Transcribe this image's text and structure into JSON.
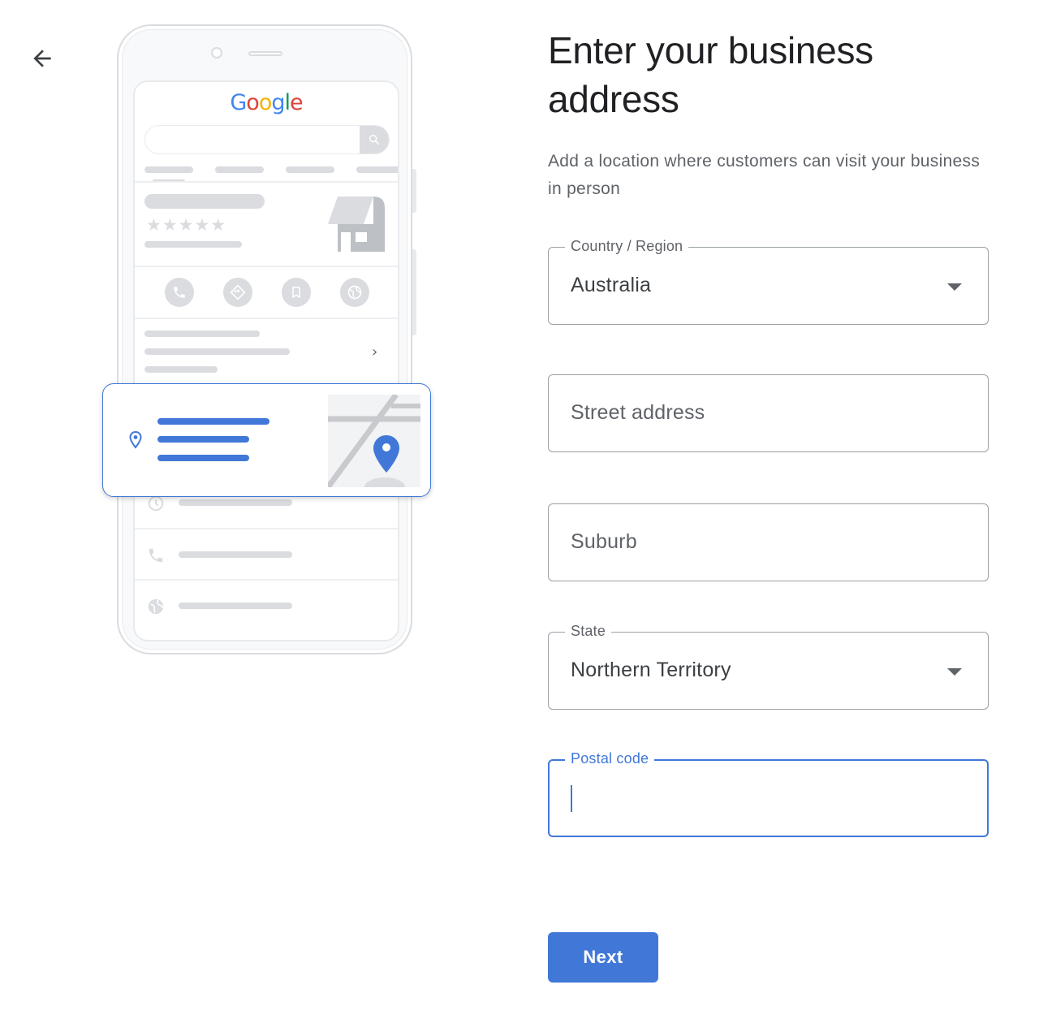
{
  "nav": {
    "back_label": "Back"
  },
  "illustration": {
    "logo_letters": [
      {
        "ch": "G",
        "color": "#4285f4"
      },
      {
        "ch": "o",
        "color": "#db4437"
      },
      {
        "ch": "o",
        "color": "#f4b400"
      },
      {
        "ch": "g",
        "color": "#4285f4"
      },
      {
        "ch": "l",
        "color": "#0f9d58"
      },
      {
        "ch": "e",
        "color": "#db4437"
      }
    ],
    "rating_stars": "★★★★★",
    "chevron": "›"
  },
  "page": {
    "title": "Enter your business address",
    "subtitle": "Add a location where customers can visit your business in person"
  },
  "form": {
    "country": {
      "label": "Country / Region",
      "value": "Australia"
    },
    "street": {
      "placeholder": "Street address",
      "value": ""
    },
    "suburb": {
      "placeholder": "Suburb",
      "value": ""
    },
    "state": {
      "label": "State",
      "value": "Northern Territory"
    },
    "postal": {
      "label": "Postal code",
      "value": ""
    }
  },
  "actions": {
    "next_label": "Next"
  },
  "colors": {
    "accent": "#4178d8",
    "border": "#9aa0a6",
    "text_secondary": "#5f6368"
  }
}
